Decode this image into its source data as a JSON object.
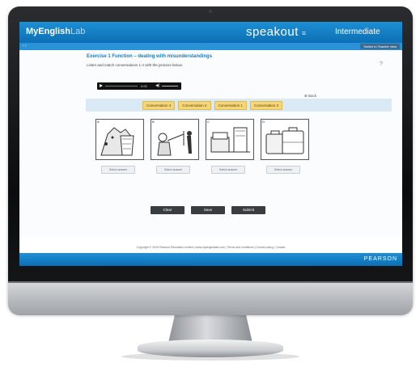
{
  "app": {
    "brand_main": "MyEnglish",
    "brand_lab": "Lab",
    "speakout": "speakout",
    "speakout_menu": "≡",
    "level": "Intermediate"
  },
  "subbar": {
    "crumb": "‹ ›   ",
    "teacher_button": "Switch to Teacher view"
  },
  "exercise": {
    "title": "Exercise 1 Function – dealing with misunderstandings",
    "instruction": "Listen and match conversations 1-4 with the pictures below.",
    "help_icon": "?",
    "back_label": "Back"
  },
  "player": {
    "time": "0:00",
    "volume_icon": "◀)"
  },
  "chips": [
    "Conversation 4",
    "Conversation 2",
    "Conversation 1",
    "Conversation 3"
  ],
  "pictures": [
    {
      "num": "A"
    },
    {
      "num": "B"
    },
    {
      "num": "C"
    },
    {
      "num": "D"
    }
  ],
  "drops": [
    "Select answer",
    "Select answer",
    "Select answer",
    "Select answer"
  ],
  "buttons": {
    "clear": "Clear",
    "save": "Save",
    "submit": "Submit"
  },
  "copyright": "Copyright © 2015 Pearson Education Limited | www.myenglishlab.com | Terms and conditions | Cookie policy | Contact",
  "footer": {
    "left": "",
    "pearson": "PEARSON"
  }
}
